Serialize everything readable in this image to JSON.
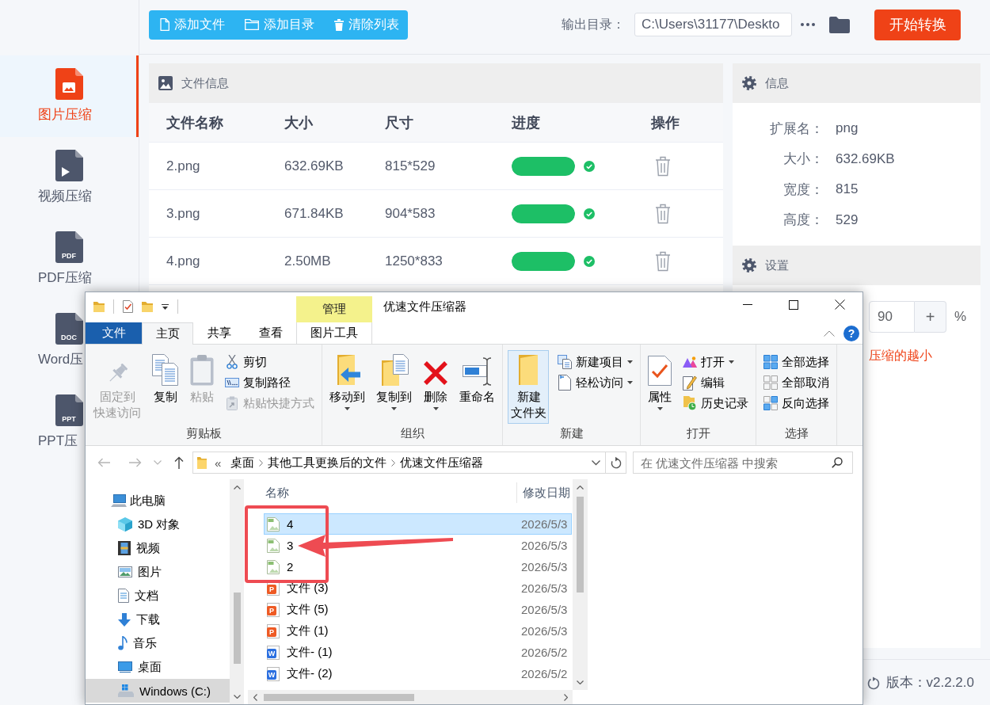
{
  "toolbar": {
    "buttons": [
      {
        "label": "添加文件"
      },
      {
        "label": "添加目录"
      },
      {
        "label": "清除列表"
      }
    ],
    "output_label": "输出目录：",
    "output_path": "C:\\Users\\31177\\Deskto",
    "start_button": "开始转换"
  },
  "sidebar": {
    "items": [
      {
        "label": "图片压缩",
        "kind": "image",
        "selected": true
      },
      {
        "label": "视频压缩",
        "kind": "video",
        "selected": false
      },
      {
        "label": "PDF压缩",
        "kind": "text",
        "icon_text": "PDF",
        "selected": false
      },
      {
        "label": "Word压",
        "kind": "text",
        "icon_text": "DOC",
        "selected": false
      },
      {
        "label": "PPT压",
        "kind": "text",
        "icon_text": "PPT",
        "selected": false
      }
    ]
  },
  "file_panel": {
    "title": "文件信息",
    "columns": [
      "文件名称",
      "大小",
      "尺寸",
      "进度",
      "操作"
    ],
    "rows": [
      {
        "name": "2.png",
        "size": "632.69KB",
        "dimensions": "815*529",
        "level": 1,
        "done": true
      },
      {
        "name": "3.png",
        "size": "671.84KB",
        "dimensions": "904*583",
        "level": 1,
        "done": true
      },
      {
        "name": "4.png",
        "size": "2.50MB",
        "dimensions": "1250*833",
        "level": 1,
        "done": true
      }
    ]
  },
  "info_panel": {
    "title": "信息",
    "fields": [
      {
        "label": "扩展名：",
        "value": "png"
      },
      {
        "label": "大小：",
        "value": "632.69KB"
      },
      {
        "label": "宽度：",
        "value": "815"
      },
      {
        "label": "高度：",
        "value": "529"
      }
    ]
  },
  "settings_panel": {
    "title": "设置",
    "quality": "90",
    "increase": "+",
    "unit": "%",
    "hint": "压缩的越小"
  },
  "footer": {
    "version": "版本：v2.2.2.0"
  },
  "explorer": {
    "context_group": "管理",
    "title": "优速文件压缩器",
    "tabs": [
      {
        "label": "文件",
        "kind": "file",
        "selected": false
      },
      {
        "label": "主页",
        "kind": "tab",
        "selected": true
      },
      {
        "label": "共享",
        "kind": "tab",
        "selected": false
      },
      {
        "label": "查看",
        "kind": "tab",
        "selected": false
      },
      {
        "label": "图片工具",
        "kind": "context",
        "selected": false
      }
    ],
    "help": "?",
    "ribbon": [
      {
        "label": "剪贴板",
        "large": [
          {
            "label": "固定到快速访问",
            "kind": "pin",
            "disabled": true,
            "dropdown": false,
            "highlighted": false
          },
          {
            "label": "复制",
            "kind": "copy",
            "disabled": false,
            "dropdown": false,
            "highlighted": false
          },
          {
            "label": "粘贴",
            "kind": "paste",
            "disabled": true,
            "dropdown": false,
            "highlighted": false
          }
        ],
        "small": [
          {
            "label": "剪切",
            "kind": "cut",
            "disabled": false,
            "dropdown": false
          },
          {
            "label": "复制路径",
            "kind": "copy_path",
            "disabled": false,
            "dropdown": false
          },
          {
            "label": "粘贴快捷方式",
            "kind": "paste_shortcut",
            "disabled": true,
            "dropdown": false
          }
        ]
      },
      {
        "label": "组织",
        "large": [
          {
            "label": "移动到",
            "kind": "move_to",
            "disabled": false,
            "dropdown": true,
            "highlighted": false
          },
          {
            "label": "复制到",
            "kind": "copy_to",
            "disabled": false,
            "dropdown": true,
            "highlighted": false
          },
          {
            "label": "删除",
            "kind": "delete",
            "disabled": false,
            "dropdown": true,
            "highlighted": false
          },
          {
            "label": "重命名",
            "kind": "rename",
            "disabled": false,
            "dropdown": false,
            "highlighted": false
          }
        ]
      },
      {
        "label": "新建",
        "large": [
          {
            "label": "新建文件夹",
            "kind": "new_folder",
            "disabled": false,
            "dropdown": false,
            "highlighted": true
          }
        ],
        "small": [
          {
            "label": "新建项目",
            "kind": "new_item",
            "disabled": false,
            "dropdown": true
          },
          {
            "label": "轻松访问",
            "kind": "easy_access",
            "disabled": false,
            "dropdown": true
          }
        ]
      },
      {
        "label": "打开",
        "large": [
          {
            "label": "属性",
            "kind": "properties",
            "disabled": false,
            "dropdown": true,
            "highlighted": false
          }
        ],
        "small": [
          {
            "label": "打开",
            "kind": "open",
            "disabled": false,
            "dropdown": true
          },
          {
            "label": "编辑",
            "kind": "edit",
            "disabled": false,
            "dropdown": false
          },
          {
            "label": "历史记录",
            "kind": "history",
            "disabled": false,
            "dropdown": false
          }
        ]
      },
      {
        "label": "选择",
        "small": [
          {
            "label": "全部选择",
            "kind": "select_all",
            "disabled": false,
            "dropdown": false
          },
          {
            "label": "全部取消",
            "kind": "select_none",
            "disabled": false,
            "dropdown": false
          },
          {
            "label": "反向选择",
            "kind": "invert_selection",
            "disabled": false,
            "dropdown": false
          }
        ]
      }
    ],
    "address": {
      "overflow": "«",
      "path": [
        "桌面",
        "其他工具更换后的文件",
        "优速文件压缩器"
      ]
    },
    "search": {
      "placeholder": "在 优速文件压缩器 中搜索"
    },
    "nav": [
      {
        "label": "此电脑",
        "kind": "pc",
        "selected": false,
        "children": [
          {
            "label": "3D 对象",
            "kind": "cube",
            "selected": false
          },
          {
            "label": "视频",
            "kind": "film",
            "selected": false
          },
          {
            "label": "图片",
            "kind": "picture",
            "selected": false
          },
          {
            "label": "文档",
            "kind": "document",
            "selected": false
          },
          {
            "label": "下载",
            "kind": "download",
            "selected": false
          },
          {
            "label": "音乐",
            "kind": "music",
            "selected": false
          },
          {
            "label": "桌面",
            "kind": "desktop",
            "selected": false
          },
          {
            "label": "Windows (C:)",
            "kind": "drive",
            "selected": true
          }
        ]
      }
    ],
    "files": {
      "columns": [
        "名称",
        "修改日期"
      ],
      "rows": [
        {
          "name": "4",
          "date": "2026/5/3",
          "kind": "image",
          "selected": true
        },
        {
          "name": "3",
          "date": "2026/5/3",
          "kind": "image",
          "selected": false
        },
        {
          "name": "2",
          "date": "2026/5/3",
          "kind": "image",
          "selected": false
        },
        {
          "name": "文件 (3)",
          "date": "2026/5/3",
          "kind": "presentation",
          "badge": "P",
          "selected": false
        },
        {
          "name": "文件 (5)",
          "date": "2026/5/3",
          "kind": "presentation",
          "badge": "P",
          "selected": false
        },
        {
          "name": "文件 (1)",
          "date": "2026/5/3",
          "kind": "presentation",
          "badge": "P",
          "selected": false
        },
        {
          "name": "文件- (1)",
          "date": "2026/5/2",
          "kind": "document",
          "badge": "W",
          "selected": false
        },
        {
          "name": "文件- (2)",
          "date": "2026/5/2",
          "kind": "document",
          "badge": "W",
          "selected": false
        }
      ]
    }
  }
}
